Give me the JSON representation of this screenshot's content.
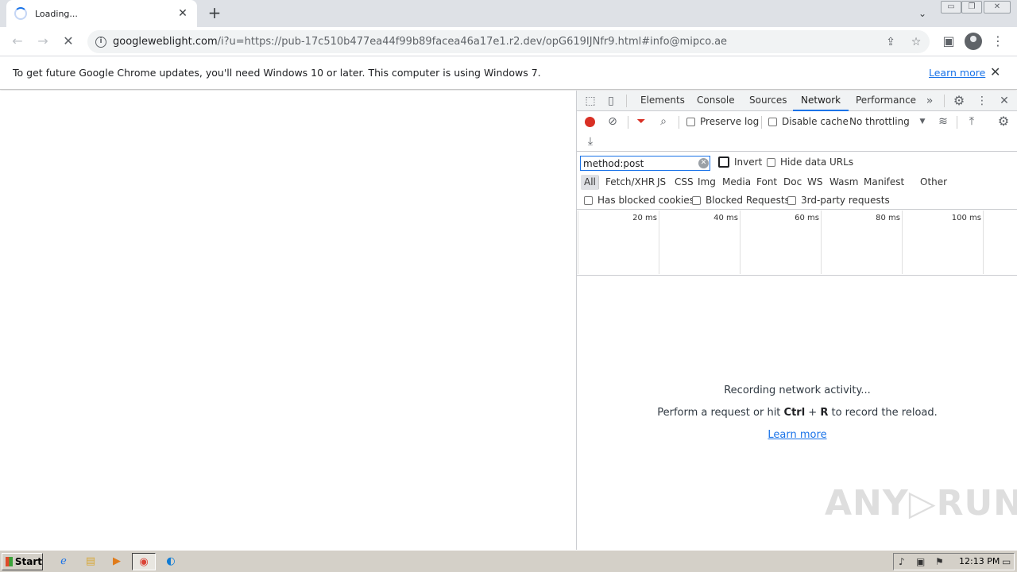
{
  "browser": {
    "tab": {
      "title": "Loading...",
      "close": "✕"
    },
    "new_tab": "+",
    "tab_search": "⌄",
    "window_controls": [
      "▭",
      "❐",
      "✕"
    ],
    "toolbar": {
      "back": "←",
      "forward": "→",
      "stop": "✕",
      "url_host": "googleweblight.com",
      "url_rest": "/i?u=https://pub-17c510b477ea44f99b89facea46a17e1.r2.dev/opG619IJNfr9.html#info@mipco.ae",
      "share": "⇪",
      "bookmark": "☆",
      "sidepanel": "▣",
      "menu": "⋮"
    }
  },
  "infobar": {
    "message": "To get future Google Chrome updates, you'll need Windows 10 or later. This computer is using Windows 7.",
    "learn_more": "Learn more",
    "close": "✕"
  },
  "devtools": {
    "tabs": [
      "Elements",
      "Console",
      "Sources",
      "Network",
      "Performance"
    ],
    "active_tab": "Network",
    "more_tabs": "»",
    "settings": "⚙",
    "menu": "⋮",
    "close": "✕",
    "toolbar": {
      "preserve_log": "Preserve log",
      "disable_cache": "Disable cache",
      "throttling": "No throttling",
      "throttle_arrow": "▼"
    },
    "filter": {
      "value": "method:post",
      "invert": "Invert",
      "hide_data_urls": "Hide data URLs",
      "types": [
        "All",
        "Fetch/XHR",
        "JS",
        "CSS",
        "Img",
        "Media",
        "Font",
        "Doc",
        "WS",
        "Wasm",
        "Manifest",
        "Other"
      ],
      "active_type": "All",
      "has_blocked_cookies": "Has blocked cookies",
      "blocked_requests": "Blocked Requests",
      "third_party": "3rd-party requests"
    },
    "timeline": [
      "20 ms",
      "40 ms",
      "60 ms",
      "80 ms",
      "100 ms"
    ],
    "empty": {
      "line1": "Recording network activity...",
      "line2_pre": "Perform a request or hit ",
      "line2_key1": "Ctrl",
      "line2_plus": " + ",
      "line2_key2": "R",
      "line2_post": " to record the reload.",
      "learn_more": "Learn more"
    }
  },
  "watermark": "ANY▷RUN",
  "taskbar": {
    "start": "Start",
    "clock": "12:13 PM"
  }
}
